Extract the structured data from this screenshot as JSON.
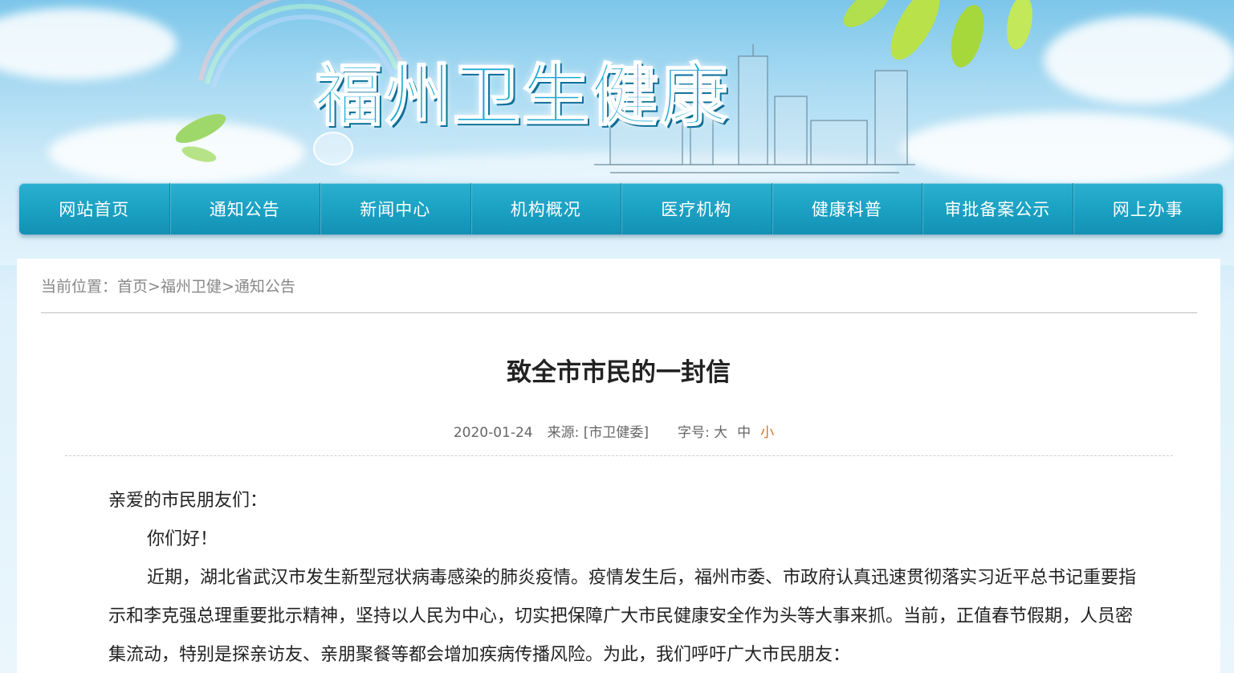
{
  "site": {
    "logo_text": "福州卫生健康"
  },
  "nav": {
    "items": [
      {
        "label": "网站首页"
      },
      {
        "label": "通知公告"
      },
      {
        "label": "新闻中心"
      },
      {
        "label": "机构概况"
      },
      {
        "label": "医疗机构"
      },
      {
        "label": "健康科普"
      },
      {
        "label": "审批备案公示"
      },
      {
        "label": "网上办事"
      }
    ]
  },
  "breadcrumb": {
    "prefix": "当前位置：",
    "items": [
      "首页",
      "福州卫健",
      "通知公告"
    ],
    "separator": ">"
  },
  "article": {
    "title": "致全市市民的一封信",
    "date": "2020-01-24",
    "source_label": "来源:",
    "source": "[市卫健委]",
    "font_size_label": "字号:",
    "font_sizes": [
      "大",
      "中",
      "小"
    ],
    "active_font_size": "小",
    "salutation": "亲爱的市民朋友们：",
    "paragraphs": [
      "你们好！",
      "近期，湖北省武汉市发生新型冠状病毒感染的肺炎疫情。疫情发生后，福州市委、市政府认真迅速贯彻落实习近平总书记重要指示和李克强总理重要批示精神，坚持以人民为中心，切实把保障广大市民健康安全作为头等大事来抓。当前，正值春节假期，人员密集流动，特别是探亲访友、亲朋聚餐等都会增加疾病传播风险。为此，我们呼吁广大市民朋友："
    ]
  },
  "colors": {
    "nav_bg": "#1aa0c2",
    "active_font_size": "#e2711d",
    "logo": "#18a8d6"
  }
}
